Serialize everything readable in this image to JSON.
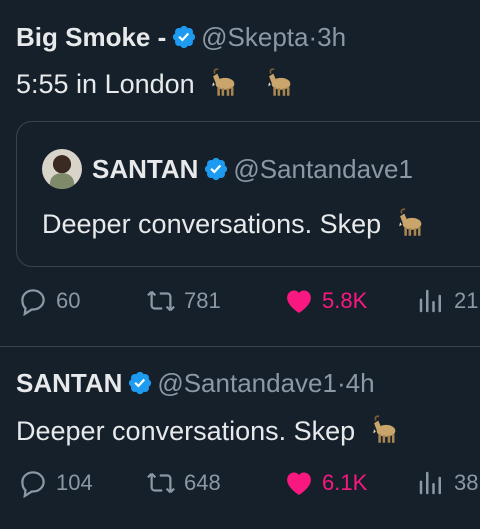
{
  "tweet1": {
    "name": "Big Smoke -",
    "handle": "@Skepta",
    "sep": "·",
    "time": "3h",
    "text": "5:55 in London",
    "emoji": "goat",
    "quote": {
      "name": "SANTAN",
      "handle": "@Santandave1",
      "text": "Deeper conversations. Skep"
    },
    "actions": {
      "replies": "60",
      "reposts": "781",
      "likes": "5.8K",
      "views": "21"
    }
  },
  "tweet2": {
    "name": "SANTAN",
    "handle": "@Santandave1",
    "sep": "·",
    "time": "4h",
    "text": "Deeper conversations. Skep",
    "actions": {
      "replies": "104",
      "reposts": "648",
      "likes": "6.1K",
      "views": "38"
    }
  },
  "colors": {
    "background": "#15202b",
    "verified": "#1d9bf0",
    "like": "#f91880",
    "muted": "#8b98a5",
    "text": "#e7e9ea"
  },
  "icons": [
    "verified-badge-icon",
    "goat-emoji-icon",
    "reply-icon",
    "repost-icon",
    "heart-icon",
    "views-icon"
  ]
}
